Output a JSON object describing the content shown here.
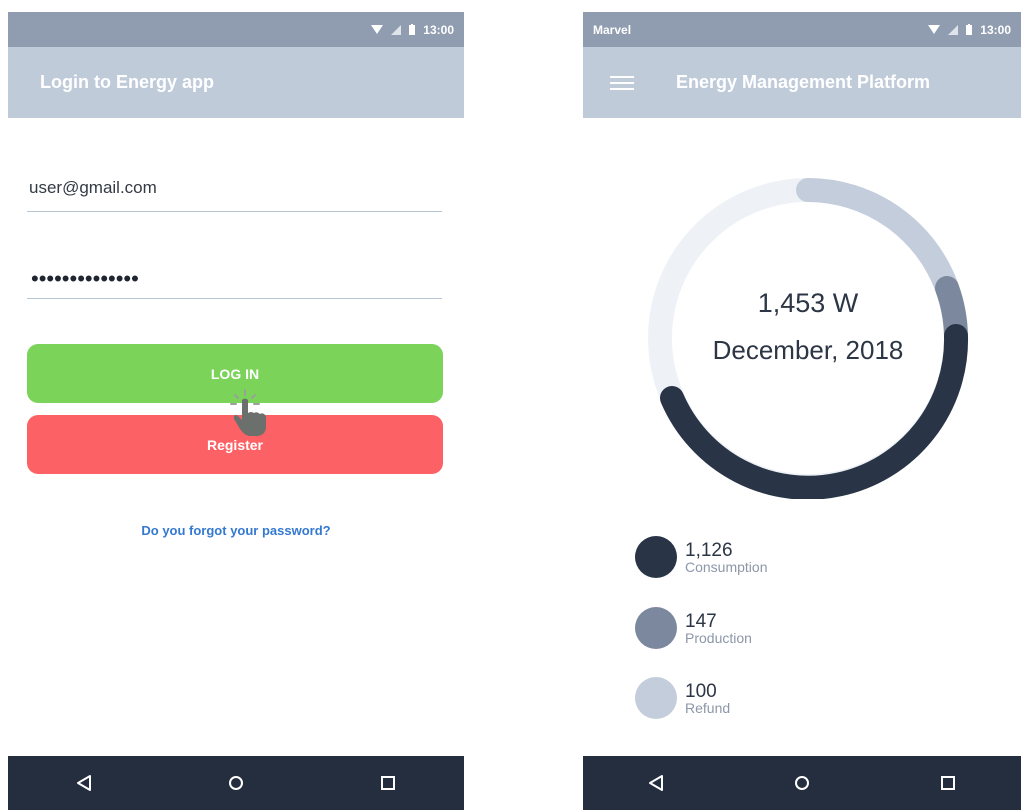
{
  "login_screen": {
    "status": {
      "time": "13:00"
    },
    "title": "Login to Energy app",
    "email_value": "user@gmail.com",
    "password_mask": "••••••••••••••",
    "login_label": "LOG IN",
    "register_label": "Register",
    "forgot_label": "Do you forgot your password?"
  },
  "dashboard_screen": {
    "status": {
      "carrier": "Marvel",
      "time": "13:00"
    },
    "title": "Energy Management Platform",
    "total": "1,453 W",
    "period": "December, 2018",
    "legend": [
      {
        "value": "1,126",
        "label": "Consumption",
        "color": "#293446"
      },
      {
        "value": "147",
        "label": "Production",
        "color": "#7c889e"
      },
      {
        "value": "100",
        "label": "Refund",
        "color": "#c3cddb"
      }
    ],
    "ring_colors": {
      "track": "#eef2f7"
    }
  },
  "colors": {
    "status_bar": "#909cb0",
    "app_bar": "#c0cbda",
    "login_green": "#7bd35a",
    "register_red": "#fc6265",
    "link_blue": "#3479d0",
    "nav_bar": "#242e3e"
  },
  "icons": {
    "wifi": "wifi-icon",
    "signal": "signal-icon",
    "battery": "battery-icon",
    "menu": "hamburger-menu-icon",
    "back": "back-triangle-icon",
    "home": "home-circle-icon",
    "recents": "recents-square-icon",
    "cursor": "hand-pointer-icon"
  }
}
